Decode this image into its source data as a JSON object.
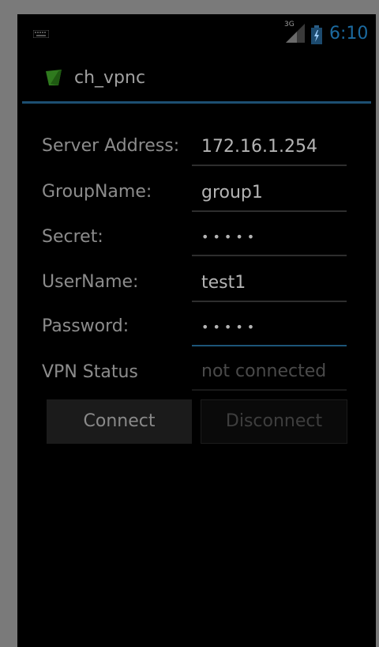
{
  "status_bar": {
    "network_type": "3G",
    "time": "6:10",
    "icons": [
      "keyboard-icon",
      "signal-icon",
      "battery-charging-icon"
    ]
  },
  "app": {
    "title": "ch_vpnc",
    "icon": "app-icon",
    "accent_color": "#1d5578"
  },
  "form": {
    "server_address": {
      "label": "Server Address:",
      "value": "172.16.1.254"
    },
    "group_name": {
      "label": "GroupName:",
      "value": "group1"
    },
    "secret": {
      "label": "Secret:",
      "value": "•••••"
    },
    "user_name": {
      "label": "UserName:",
      "value": "test1"
    },
    "password": {
      "label": "Password:",
      "value": "•••••"
    },
    "vpn_status": {
      "label": "VPN Status",
      "value": "not connected"
    }
  },
  "buttons": {
    "connect": "Connect",
    "disconnect": "Disconnect"
  }
}
